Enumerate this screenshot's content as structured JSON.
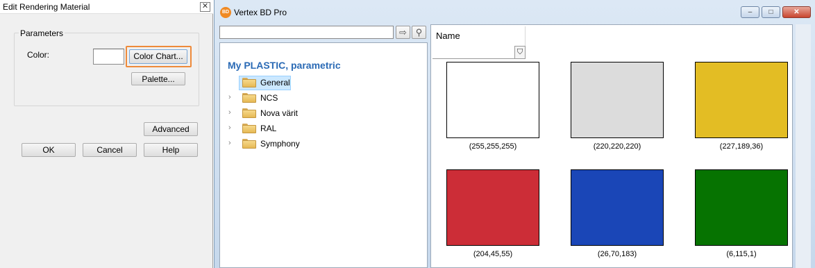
{
  "dialog": {
    "title": "Edit Rendering Material",
    "close_glyph": "✕",
    "group_label": "Parameters",
    "color_label": "Color:",
    "color_chart_button": "Color Chart...",
    "palette_button": "Palette...",
    "advanced_button": "Advanced",
    "ok_button": "OK",
    "cancel_button": "Cancel",
    "help_button": "Help",
    "swatch_color": "#ffffff",
    "highlight_color": "#ee8a3a"
  },
  "window": {
    "title": "Vertex BD Pro",
    "app_icon_text": "BD",
    "minimize_glyph": "–",
    "maximize_glyph": "□",
    "close_glyph": "✕"
  },
  "search": {
    "value": "",
    "go_icon": "arrow-right-icon",
    "go_glyph": "⇨",
    "find_icon": "magnifier-icon",
    "find_glyph": "⚲"
  },
  "tree": {
    "heading": "My PLASTIC, parametric",
    "items": [
      {
        "label": "General",
        "expandable": false,
        "selected": true
      },
      {
        "label": "NCS",
        "expandable": true,
        "selected": false
      },
      {
        "label": "Nova värit",
        "expandable": true,
        "selected": false
      },
      {
        "label": "RAL",
        "expandable": true,
        "selected": false
      },
      {
        "label": "Symphony",
        "expandable": true,
        "selected": false
      }
    ],
    "chevron_glyph": "›"
  },
  "grid": {
    "column_header": "Name",
    "filter_icon": "filter-icon",
    "filter_glyph": "⛉",
    "colors": [
      {
        "label": "(255,255,255)",
        "hex": "#ffffff"
      },
      {
        "label": "(220,220,220)",
        "hex": "#dcdcdc"
      },
      {
        "label": "(227,189,36)",
        "hex": "#e3bd24"
      },
      {
        "label": "(204,45,55)",
        "hex": "#cc2d37"
      },
      {
        "label": "(26,70,183)",
        "hex": "#1a46b7"
      },
      {
        "label": "(6,115,1)",
        "hex": "#067301"
      }
    ]
  }
}
